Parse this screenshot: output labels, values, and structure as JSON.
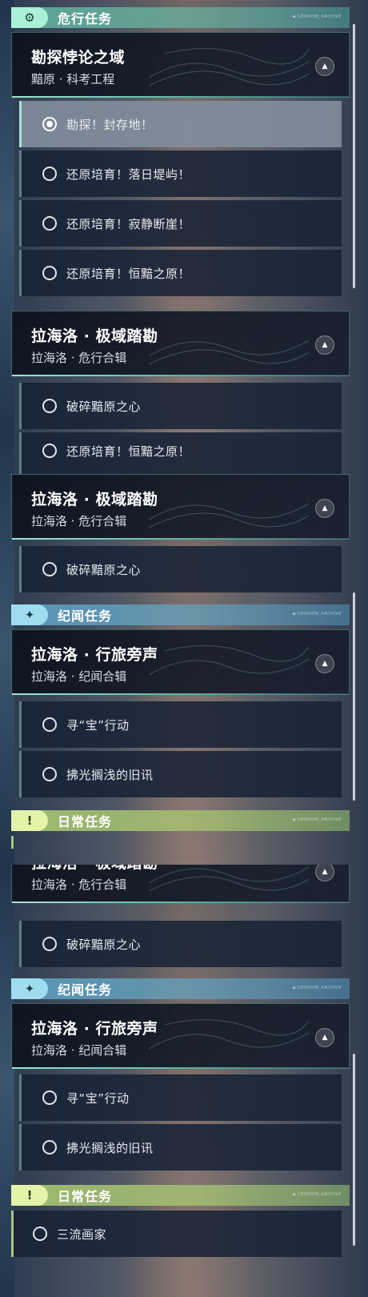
{
  "sections": {
    "danger": {
      "title": "危行任务",
      "tag_icon": "gear-icon",
      "tiny": "◆ GENSHIN_ARCHIVE"
    },
    "lore": {
      "title": "纪闻任务",
      "tag_icon": "sparkle-icon",
      "tiny": "◆ GENSHIN_ARCHIVE"
    },
    "daily": {
      "title": "日常任务",
      "tag_icon": "exclamation-box-icon",
      "tiny": "◆ GENSHIN_ARCHIVE"
    }
  },
  "quests": {
    "paradox": {
      "title": "勘探悖论之域",
      "subtitle": "黯原 · 科考工程"
    },
    "polar": {
      "title": "拉海洛 · 极域踏勘",
      "subtitle": "拉海洛 · 危行合辑"
    },
    "travel": {
      "title": "拉海洛 · 行旅旁声",
      "subtitle": "拉海洛 · 纪闻合辑"
    }
  },
  "tasks": {
    "explore": "勘探！封存地！",
    "restore_sunset": "还原培育！落日堤屿！",
    "restore_silent": "还原培育！寂静断崖！",
    "restore_eternal": "还原培育！恒黯之原！",
    "shatter_heart": "破碎黯原之心",
    "treasure": "寻“宝”行动",
    "old_news": "拂光搁浅的旧讯",
    "painter": "三流画家"
  },
  "colors": {
    "danger": "#a9f0d7",
    "lore": "#9fdcf0",
    "daily": "#e3f3a8",
    "selected": "#828e9c"
  }
}
